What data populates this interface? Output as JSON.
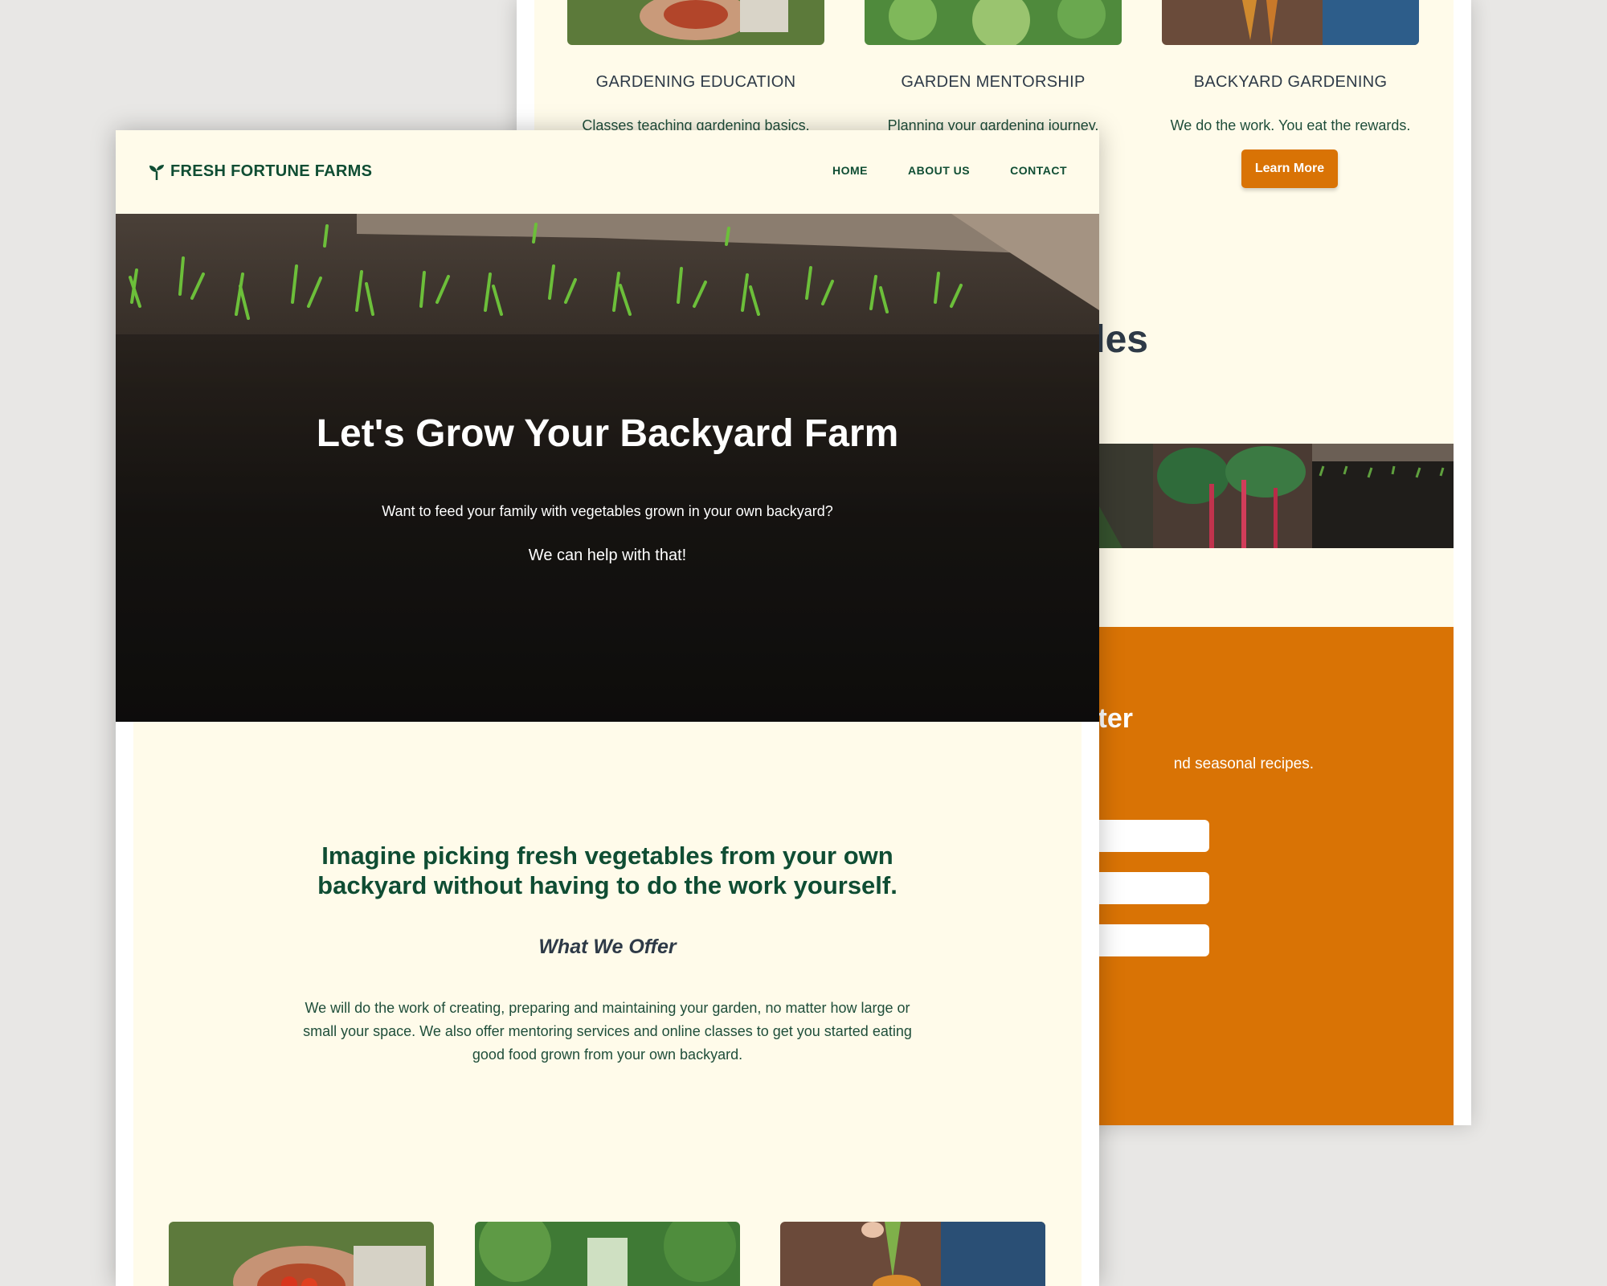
{
  "services": [
    {
      "title": "GARDENING EDUCATION",
      "text": "Classes teaching gardening basics."
    },
    {
      "title": "GARDEN MENTORSHIP",
      "text": "Planning your gardening journey."
    },
    {
      "title": "BACKYARD GARDENING",
      "text": "We do the work. You eat the rewards."
    }
  ],
  "services_button": "Learn More",
  "back_heading": "bles",
  "newsletter": {
    "title_fragment": "ter",
    "text_fragment": "nd seasonal recipes."
  },
  "brand": {
    "name": "FRESH FORTUNE FARMS",
    "icon": "sprout-icon"
  },
  "nav": {
    "home": "HOME",
    "about": "ABOUT US",
    "contact": "CONTACT"
  },
  "hero": {
    "title": "Let's Grow Your Backyard Farm",
    "subtitle": "Want to feed your family with vegetables grown in your own backyard?",
    "subtitle2": "We can help with that!"
  },
  "intro": {
    "title": "Imagine picking fresh vegetables from your own backyard without having to do the work yourself.",
    "offer_heading": "What We Offer",
    "text": "We will do the work of creating, preparing and maintaining your garden, no matter how large or small your space. We also offer mentoring services and online classes to get you started eating good food grown from your own backyard."
  },
  "colors": {
    "brand_green": "#0f4d33",
    "accent_orange": "#d97305",
    "page_bg": "#fffbea"
  }
}
